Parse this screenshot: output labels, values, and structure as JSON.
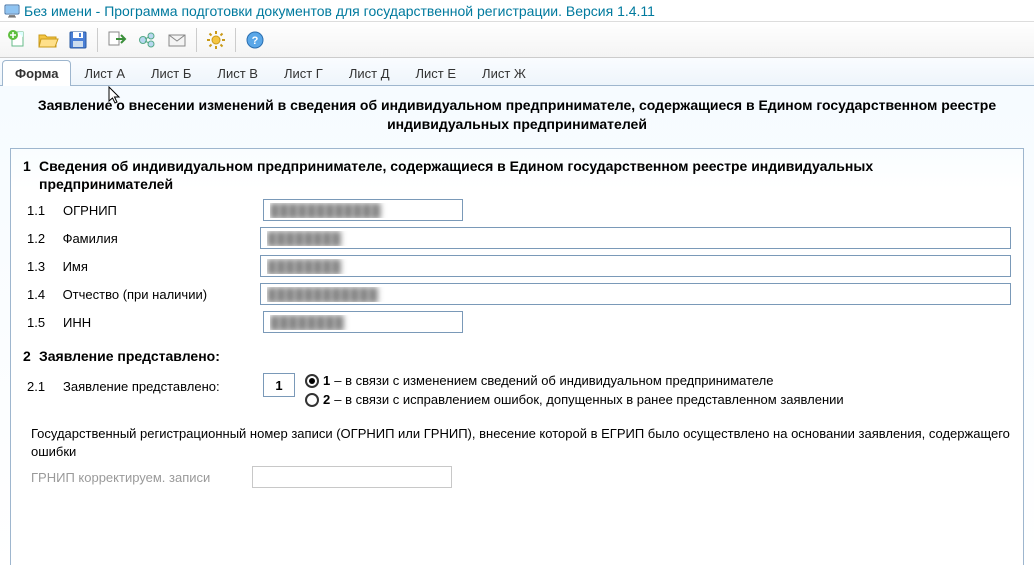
{
  "titlebar": {
    "title": "Без имени - Программа подготовки документов для государственной регистрации. Версия 1.4.11"
  },
  "toolbar_icons": [
    "new-file-icon",
    "open-folder-icon",
    "save-icon",
    "export-icon",
    "send-icon",
    "mail-icon",
    "settings-icon",
    "help-icon"
  ],
  "tabs": [
    {
      "label": "Форма",
      "active": true
    },
    {
      "label": "Лист А",
      "active": false
    },
    {
      "label": "Лист Б",
      "active": false
    },
    {
      "label": "Лист В",
      "active": false
    },
    {
      "label": "Лист Г",
      "active": false
    },
    {
      "label": "Лист Д",
      "active": false
    },
    {
      "label": "Лист Е",
      "active": false
    },
    {
      "label": "Лист Ж",
      "active": false
    }
  ],
  "header": "Заявление о внесении изменений в сведения об индивидуальном предпринимателе, содержащиеся в Едином государственном реестре индивидуальных предпринимателей",
  "section1": {
    "num": "1",
    "title": "Сведения об индивидуальном предпринимателе, содержащиеся в Едином государственном реестре индивидуальных предпринимателей",
    "fields": [
      {
        "num": "1.1",
        "label": "ОГРНИП",
        "value": "████████████",
        "wide": false
      },
      {
        "num": "1.2",
        "label": "Фамилия",
        "value": "████████",
        "wide": true
      },
      {
        "num": "1.3",
        "label": "Имя",
        "value": "████████",
        "wide": true
      },
      {
        "num": "1.4",
        "label": "Отчество (при наличии)",
        "value": "████████████",
        "wide": true
      },
      {
        "num": "1.5",
        "label": "ИНН",
        "value": "████████",
        "wide": false
      }
    ]
  },
  "section2": {
    "num": "2",
    "title": "Заявление представлено:",
    "sub_num": "2.1",
    "sub_label": "Заявление представлено:",
    "boxvalue": "1",
    "options": [
      {
        "key": "1",
        "label": "– в связи с изменением сведений об индивидуальном предпринимателе",
        "checked": true
      },
      {
        "key": "2",
        "label": "– в связи с исправлением ошибок, допущенных в ранее представленном заявлении",
        "checked": false
      }
    ],
    "note": "Государственный регистрационный номер записи (ОГРНИП или ГРНИП), внесение которой в ЕГРИП  было осуществлено на основании заявления, содержащего ошибки",
    "disabled_label": "ГРНИП корректируем. записи",
    "disabled_value": ""
  }
}
